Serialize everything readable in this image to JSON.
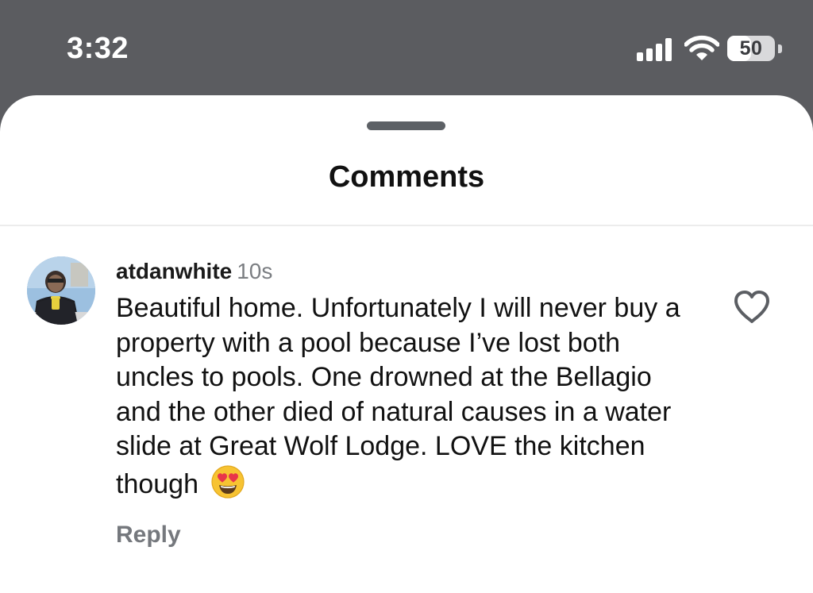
{
  "status_bar": {
    "time": "3:32",
    "battery_level": "50",
    "signal_icon": "cellular-signal-icon",
    "wifi_icon": "wifi-icon",
    "battery_icon": "battery-icon",
    "battery_fill_fraction": 0.5
  },
  "sheet": {
    "title": "Comments",
    "handle_icon": "drag-handle"
  },
  "comments": [
    {
      "username": "atdanwhite",
      "time": "10s",
      "text": "Beautiful home. Unfortunately I will never buy a property with a pool because I’ve lost both uncles to pools. One drowned at the Bellagio and the other died of natural causes in a water slide at Great Wolf Lodge. LOVE the kitchen though",
      "emoji": "heart-eyes-emoji",
      "reply_label": "Reply",
      "like_icon": "heart-outline-icon"
    }
  ],
  "colors": {
    "status_bar_bg": "#5b5c60",
    "sheet_bg": "#ffffff",
    "text_primary": "#111111",
    "text_secondary": "#75787d"
  }
}
